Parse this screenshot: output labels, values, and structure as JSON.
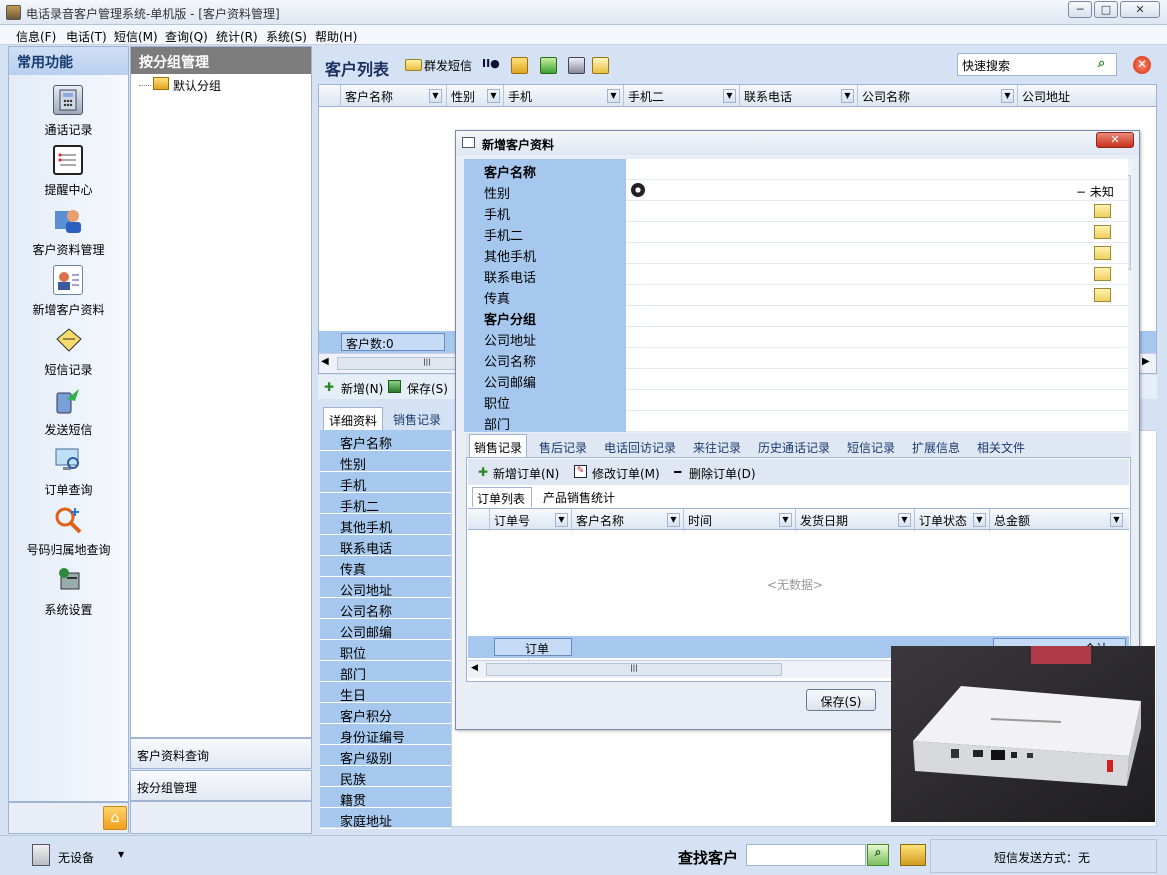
{
  "window": {
    "title": "电话录音客户管理系统-单机版 - [客户资料管理]",
    "min": "─",
    "max": "□",
    "close": "✕"
  },
  "menu": [
    "信息(F)",
    "电话(T)",
    "短信(M)",
    "查询(Q)",
    "统计(R)",
    "系统(S)",
    "帮助(H)"
  ],
  "leftnav": {
    "header": "常用功能",
    "items": [
      "通话记录",
      "提醒中心",
      "客户资料管理",
      "新增客户资料",
      "短信记录",
      "发送短信",
      "订单查询",
      "号码归属地查询",
      "系统设置"
    ]
  },
  "grouppanel": {
    "header": "按分组管理",
    "tree_item": "默认分组",
    "btn_query": "客户资料查询",
    "btn_group": "按分组管理"
  },
  "list": {
    "title": "客户列表",
    "bulk_sms": "群发短信",
    "search_placeholder": "快速搜索",
    "columns": [
      "客户名称",
      "性别",
      "手机",
      "手机二",
      "联系电话",
      "公司名称",
      "公司地址"
    ],
    "count_label": "客户数:0"
  },
  "actions": {
    "add": "新增(N)",
    "save": "保存(S)"
  },
  "detail": {
    "tabs": [
      "详细资料",
      "销售记录"
    ],
    "fields": [
      "客户名称",
      "性别",
      "手机",
      "手机二",
      "其他手机",
      "联系电话",
      "传真",
      "公司地址",
      "公司名称",
      "公司邮编",
      "职位",
      "部门",
      "生日",
      "客户积分",
      "身份证编号",
      "客户级别",
      "民族",
      "籍贯",
      "家庭地址"
    ]
  },
  "modal": {
    "title": "新增客户资料",
    "close": "✕",
    "gender_value": "未知",
    "rows": [
      {
        "label": "客户名称",
        "bold": true
      },
      {
        "label": "性别",
        "bold": false
      },
      {
        "label": "手机",
        "bold": false,
        "mail": true
      },
      {
        "label": "手机二",
        "bold": false,
        "mail": true
      },
      {
        "label": "其他手机",
        "bold": false,
        "mail": true
      },
      {
        "label": "联系电话",
        "bold": false,
        "mail": true
      },
      {
        "label": "传真",
        "bold": false,
        "mail": true
      },
      {
        "label": "客户分组",
        "bold": true
      },
      {
        "label": "公司地址",
        "bold": false
      },
      {
        "label": "公司名称",
        "bold": false
      },
      {
        "label": "公司邮编",
        "bold": false
      },
      {
        "label": "职位",
        "bold": false
      },
      {
        "label": "部门",
        "bold": false
      }
    ],
    "tabs": [
      "销售记录",
      "售后记录",
      "电话回访记录",
      "来往记录",
      "历史通话记录",
      "短信记录",
      "扩展信息",
      "相关文件"
    ],
    "order_actions": [
      "新增订单(N)",
      "修改订单(M)",
      "删除订单(D)"
    ],
    "subtabs": [
      "订单列表",
      "产品销售统计"
    ],
    "order_columns": [
      "订单号",
      "客户名称",
      "时间",
      "发货日期",
      "订单状态",
      "总金额"
    ],
    "no_data": "<无数据>",
    "order_count": "订单数:0",
    "total_label": "合计",
    "save": "保存(S)"
  },
  "status": {
    "device": "无设备",
    "find_label": "查找客户",
    "sms_mode": "短信发送方式：无"
  }
}
